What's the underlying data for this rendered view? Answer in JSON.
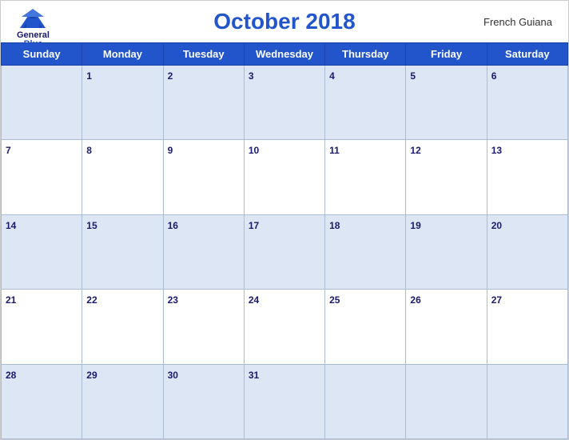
{
  "header": {
    "title": "October 2018",
    "region": "French Guiana",
    "logo": {
      "line1": "General",
      "line2": "Blue"
    }
  },
  "weekdays": [
    "Sunday",
    "Monday",
    "Tuesday",
    "Wednesday",
    "Thursday",
    "Friday",
    "Saturday"
  ],
  "weeks": [
    [
      null,
      1,
      2,
      3,
      4,
      5,
      6
    ],
    [
      7,
      8,
      9,
      10,
      11,
      12,
      13
    ],
    [
      14,
      15,
      16,
      17,
      18,
      19,
      20
    ],
    [
      21,
      22,
      23,
      24,
      25,
      26,
      27
    ],
    [
      28,
      29,
      30,
      31,
      null,
      null,
      null
    ]
  ]
}
